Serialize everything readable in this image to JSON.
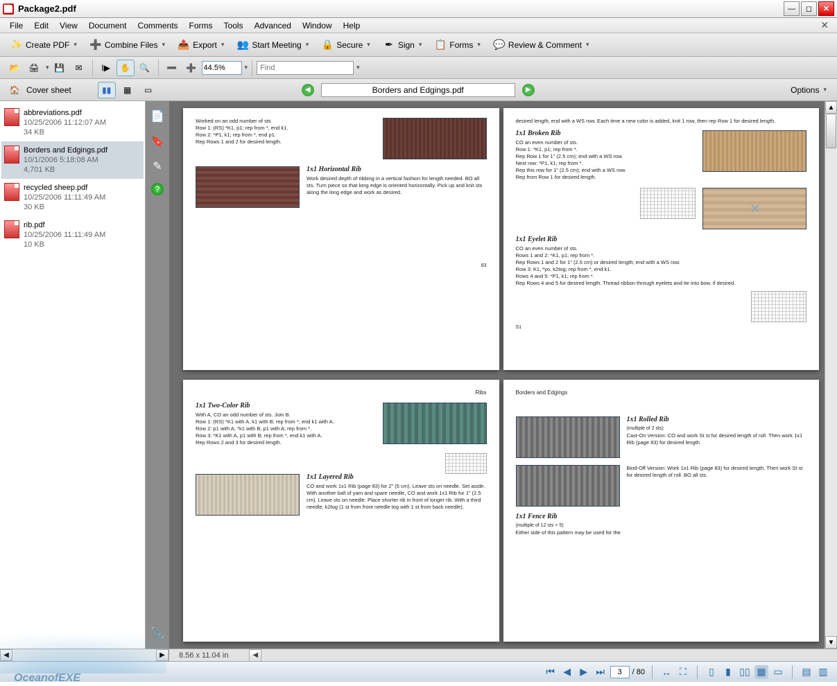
{
  "window": {
    "title": "Package2.pdf"
  },
  "menu": [
    "File",
    "Edit",
    "View",
    "Document",
    "Comments",
    "Forms",
    "Tools",
    "Advanced",
    "Window",
    "Help"
  ],
  "toolbar1": {
    "create": "Create PDF",
    "combine": "Combine Files",
    "export": "Export",
    "meeting": "Start Meeting",
    "secure": "Secure",
    "sign": "Sign",
    "forms": "Forms",
    "review": "Review & Comment"
  },
  "toolbar2": {
    "zoom": "44.5%",
    "find_placeholder": "Find"
  },
  "docnav": {
    "cover": "Cover sheet",
    "current_doc": "Borders and Edgings.pdf",
    "options": "Options"
  },
  "files": [
    {
      "name": "abbreviations.pdf",
      "date": "10/25/2006 11:12:07 AM",
      "size": "34 KB"
    },
    {
      "name": "Borders and Edgings.pdf",
      "date": "10/1/2006 5:18:08 AM",
      "size": "4,701 KB"
    },
    {
      "name": "recycled sheep.pdf",
      "date": "10/25/2006 11:11:49 AM",
      "size": "30 KB"
    },
    {
      "name": "rib.pdf",
      "date": "10/25/2006 11:11:49 AM",
      "size": "10 KB"
    }
  ],
  "pagecontent": {
    "p1": {
      "intro1": "Worked on an odd number of sts",
      "intro2": "Row 1: (RS) *K1, p1; rep from *, end k1.",
      "intro3": "Row 2: *P1, k1; rep from *, end p1.",
      "intro4": "Rep Rows 1 and 2 for desired length.",
      "h1": "1x1  Horizontal  Rib",
      "b1": "Work desired depth of ribbing in a vertical fashion for length needed. BO all sts. Turn piece so that long edge is oriented horizontally. Pick up and knit sts along the long edge and work as desired.",
      "pgno": "83"
    },
    "p2": {
      "top": "desired length; end with a WS row. Each time a new color is added, knit 1 row, then rep Row 1 for desired length.",
      "h1": "1x1  Broken  Rib",
      "b1a": "CO an even number of sts.",
      "b1b": "Row 1: *K1, p1; rep from *.",
      "b1c": "Rep Row 1 for 1\" (2.5 cm); end with a WS row.",
      "b1d": "Next row: *P1, k1; rep from *.",
      "b1e": "Rep this row for 1\" (2.5 cm); end with a WS row.",
      "b1f": "Rep from Row 1 for desired length.",
      "h2": "1x1  Eyelet  Rib",
      "b2a": "CO an even number of sts.",
      "b2b": "Rows 1 and 2: *K1, p1; rep from *.",
      "b2c": "Rep Rows 1 and 2 for 1\" (2.5 cm) or desired length; end with a WS row.",
      "b2d": "Row 3: K1, *yo, k2tog; rep from *, end k1.",
      "b2e": "Rows 4 and 5: *P1, k1; rep from *.",
      "b2f": "Rep Rows 4 and 5 for desired length. Thread ribbon through eyelets and tie into bow, if desired.",
      "pgno": "S1"
    },
    "p3": {
      "corner": "Ribs",
      "h1": "1x1  Two-Color  Rib",
      "b1a": "With A, CO an odd number of sts. Join B.",
      "b1b": "Row 1: (RS) *K1 with A, k1 with B; rep from *, end k1 with A.",
      "b1c": "Row 2: p1 with A, *k1 with B, p1 with A; rep from *.",
      "b1d": "Row 3: *K1 with A, p1 with B; rep from *, end k1 with A.",
      "b1e": "Rep Rows 2 and 3 for desired length.",
      "h2": "1x1  Layered  Rib",
      "b2": "CO and work 1x1 Rib (page 83) for 2\" (5 cm). Leave sts on needle. Set aside. With another ball of yarn and spare needle, CO and work 1x1 Rib for 1\" (2.5 cm). Leave sts on needle. Place shorter rib in front of longer rib. With a third needle, k2tog (1 st from front needle tog with 1 st from back needle)."
    },
    "p4": {
      "corner": "Borders and Edgings",
      "h1": "1x1  Rolled  Rib",
      "sub1": "(multiple of 2 sts)",
      "b1": "Cast-On Version: CO and work St st for desired length of roll. Then work 1x1 Rib (page 83) for desired length.",
      "b2": "Bind-Off Version: Work 1x1 Rib (page 83) for desired length. Then work St st for desired length of roll. BO all sts.",
      "h2": "1x1  Fence  Rib",
      "sub2": "(multiple of 12 sts + 5)",
      "b3": "Either side of this pattern may be used for the"
    }
  },
  "bottom": {
    "dims": "8.56 x 11.04 in",
    "page": "3",
    "total": "/ 80"
  },
  "watermark": "OceanofEXE"
}
